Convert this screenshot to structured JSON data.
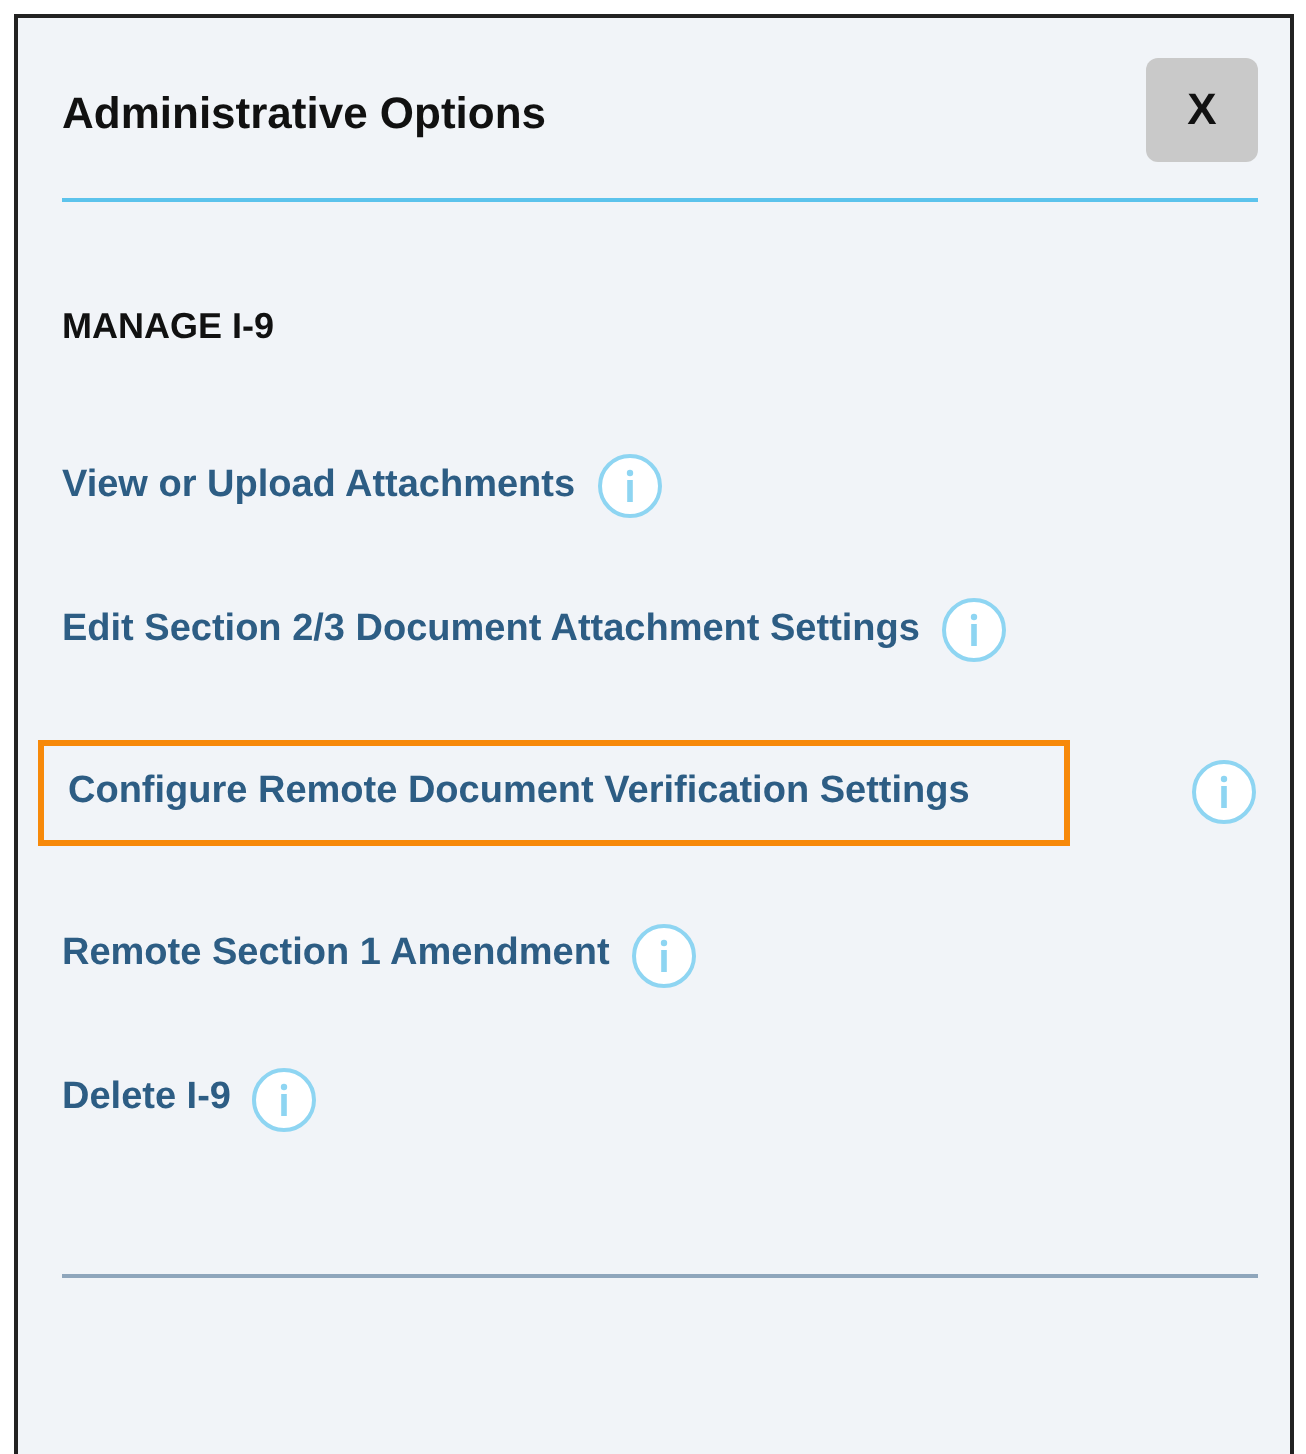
{
  "panel": {
    "title": "Administrative Options",
    "close_label": "X"
  },
  "section": {
    "heading": "MANAGE I-9",
    "items": [
      {
        "label": "View or Upload Attachments",
        "highlighted": false
      },
      {
        "label": "Edit Section 2/3 Document Attachment Settings",
        "highlighted": false
      },
      {
        "label": "Configure Remote Document Verification Settings",
        "highlighted": true
      },
      {
        "label": "Remote Section 1 Amendment",
        "highlighted": false
      },
      {
        "label": "Delete I-9",
        "highlighted": false
      }
    ]
  }
}
